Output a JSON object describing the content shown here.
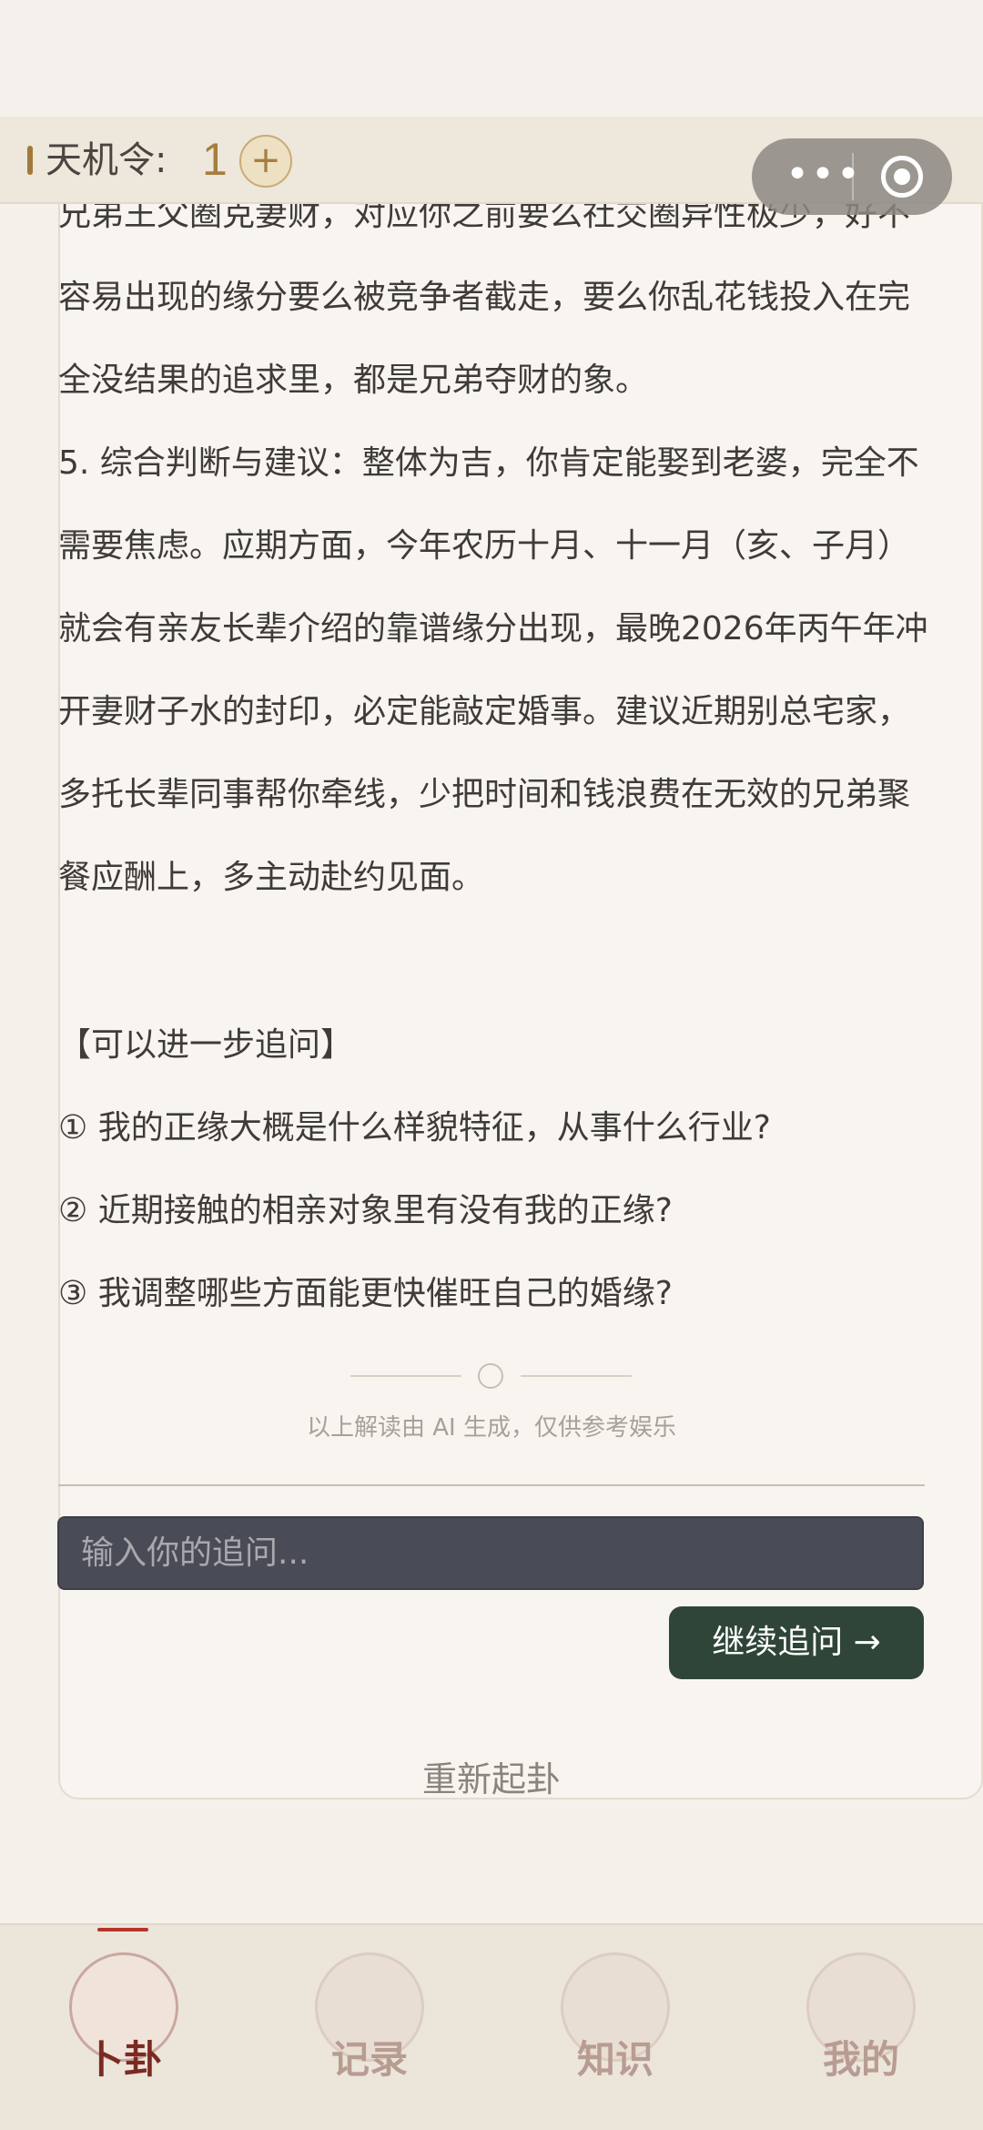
{
  "header": {
    "tianji_label": "天机令:",
    "tianji_count": "1",
    "add_symbol": "+"
  },
  "capsule": {
    "more_icon": "more-dots-icon",
    "close_icon": "target-circle-icon"
  },
  "content": {
    "para_1": "兄弟王父圈克妻财，对应你之前要么社交圈异性极少，好不容易出现的缘分要么被竞争者截走，要么你乱花钱投入在完全没结果的追求里，都是兄弟夺财的象。",
    "para_2": "5. 综合判断与建议：整体为吉，你肯定能娶到老婆，完全不需要焦虑。应期方面，今年农历十月、十一月（亥、子月）就会有亲友长辈介绍的靠谱缘分出现，最晚2026年丙午年冲开妻财子水的封印，必定能敲定婚事。建议近期别总宅家，多托长辈同事帮你牵线，少把时间和钱浪费在无效的兄弟聚餐应酬上，多主动赴约见面。",
    "followup_title": "【可以进一步追问】",
    "questions": [
      "① 我的正缘大概是什么样貌特征，从事什么行业?",
      "② 近期接触的相亲对象里有没有我的正缘?",
      "③ 我调整哪些方面能更快催旺自己的婚缘?"
    ],
    "disclaimer": "以上解读由 AI 生成，仅供参考娱乐"
  },
  "input": {
    "placeholder": "输入你的追问..."
  },
  "send_label": "继续追问 →",
  "restart_label": "重新起卦",
  "tabs": [
    {
      "label": "卜卦",
      "icon": "bagua-icon",
      "active": true
    },
    {
      "label": "记录",
      "icon": "scroll-icon",
      "active": false
    },
    {
      "label": "知识",
      "icon": "book-icon",
      "active": false
    },
    {
      "label": "我的",
      "icon": "compass-icon",
      "active": false
    }
  ],
  "colors": {
    "accent": "#a57f3f",
    "button": "#2f4538",
    "active_tab": "#7b2a22"
  }
}
